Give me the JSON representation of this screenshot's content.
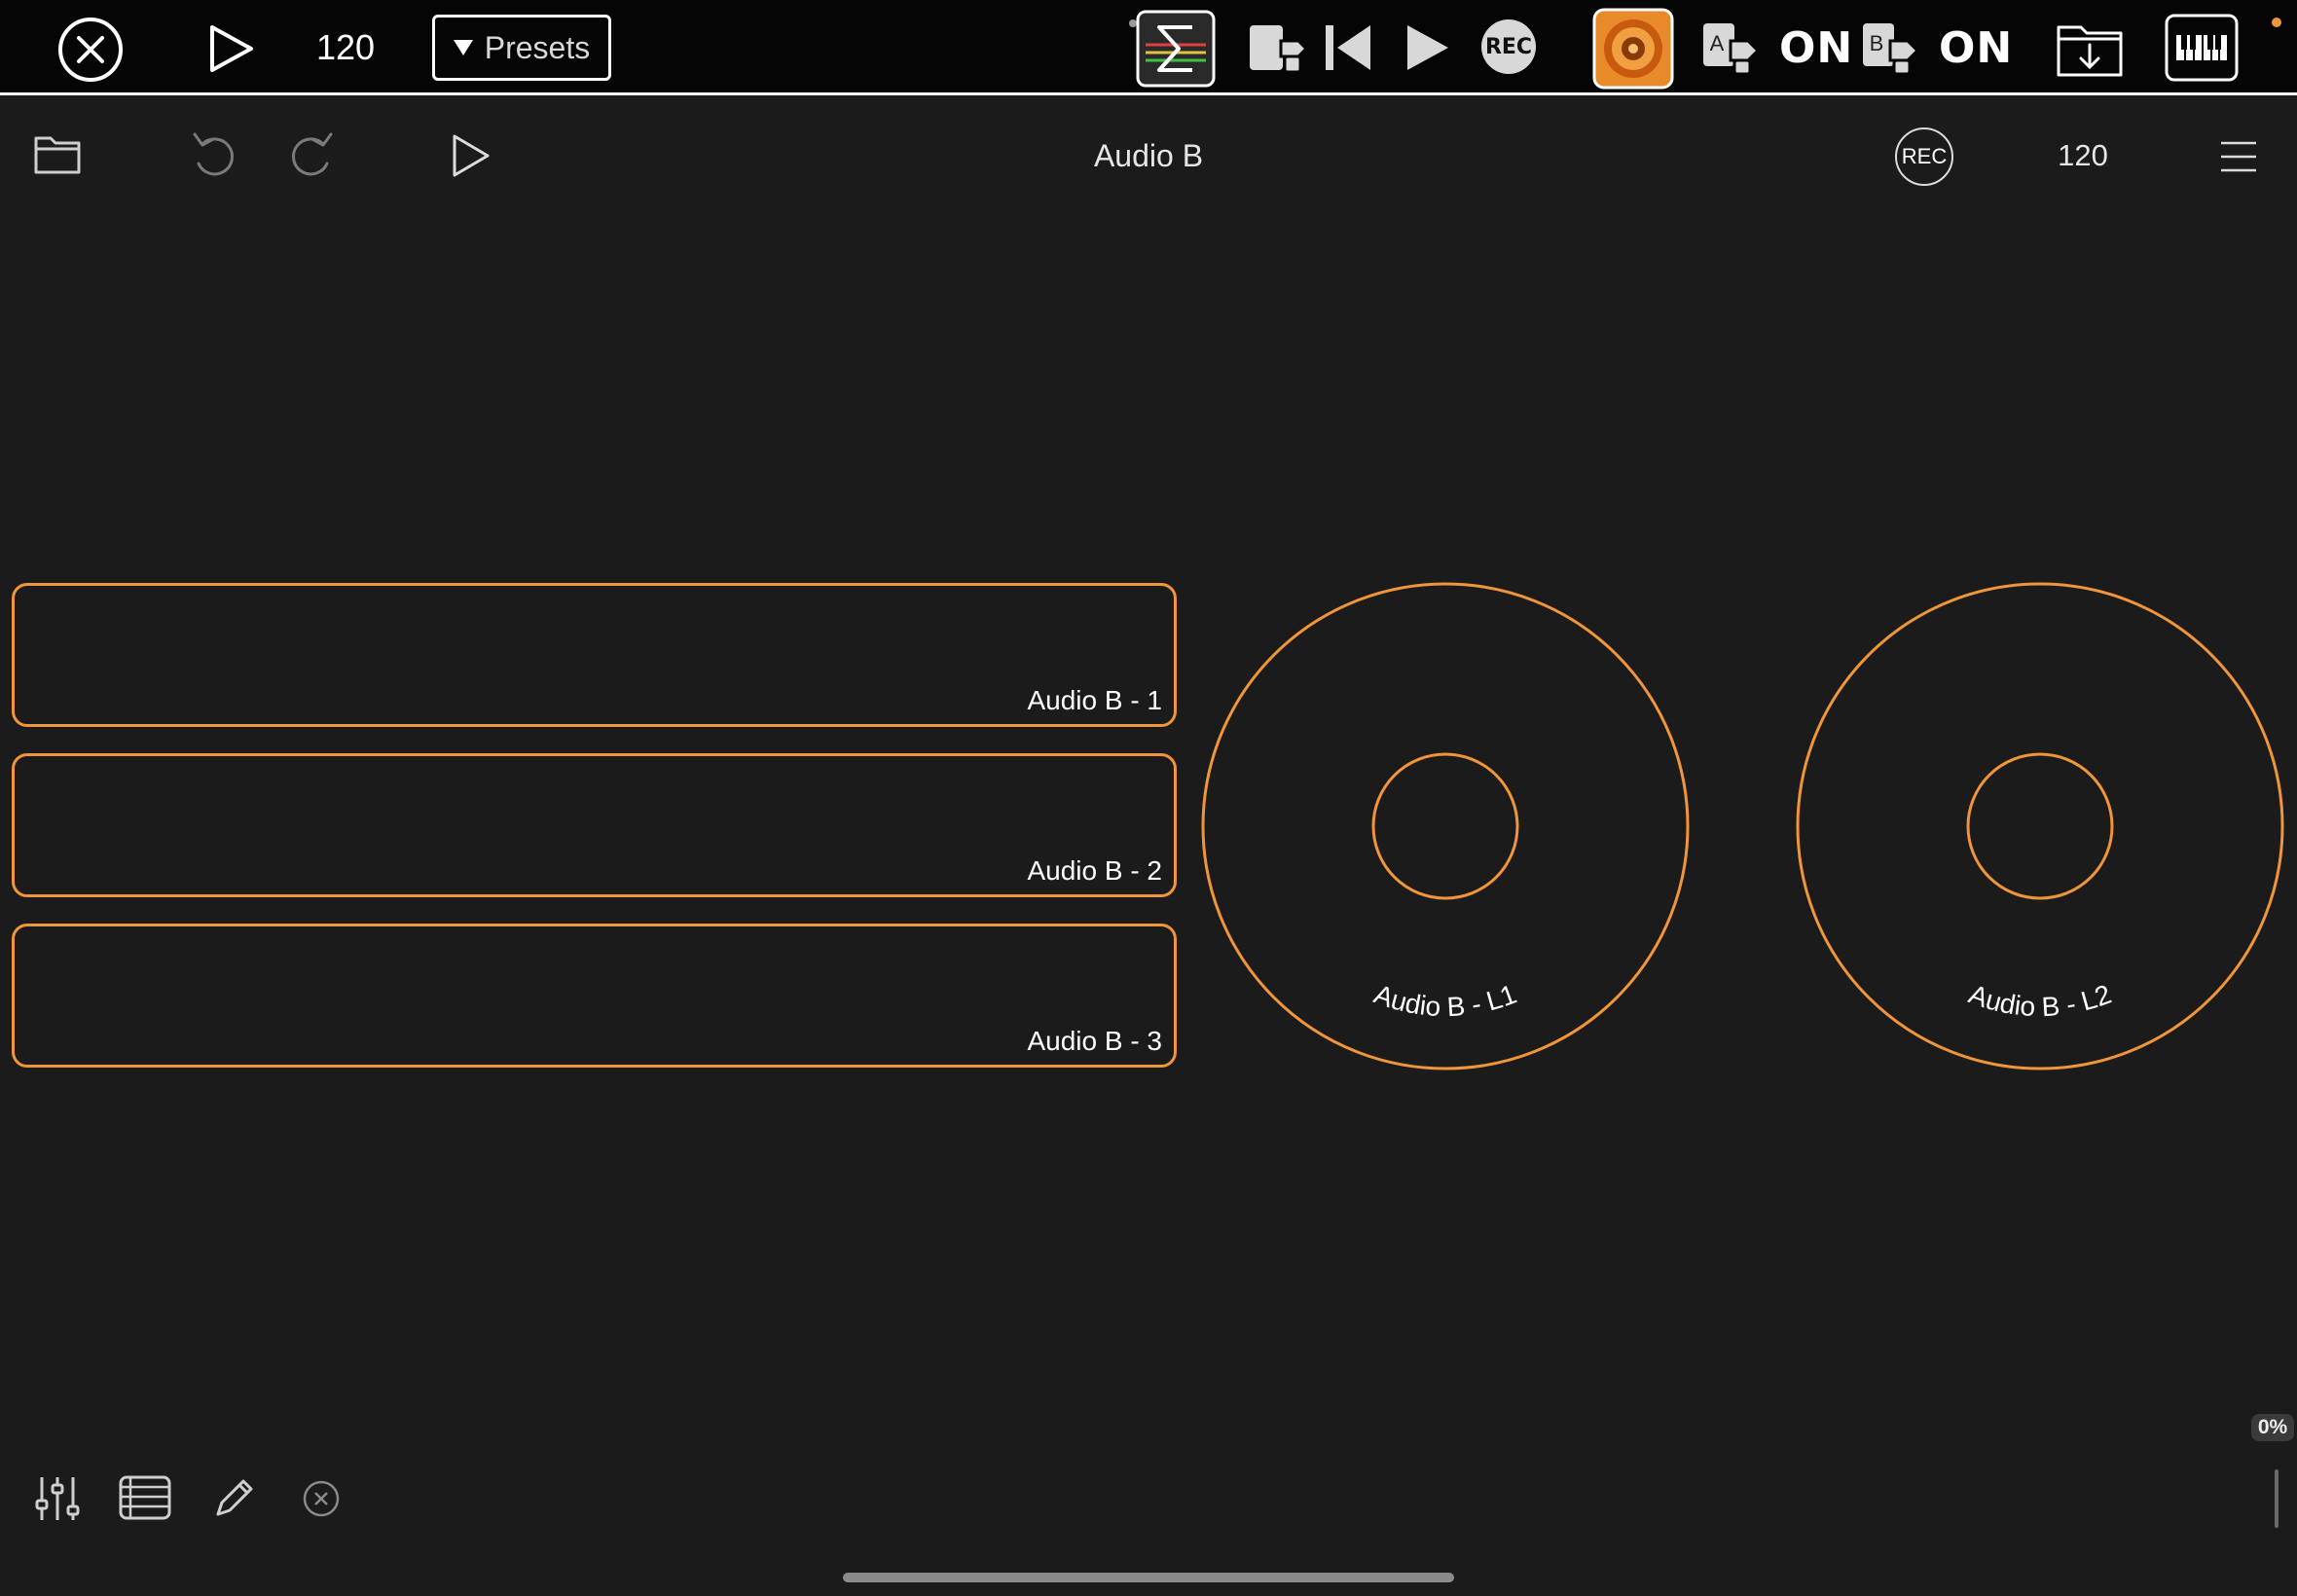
{
  "host_bar": {
    "tempo": "120",
    "presets_label": "Presets",
    "rec_label": "REC",
    "a_label": "A",
    "b_label": "B",
    "a_state": "ON",
    "b_state": "ON"
  },
  "app_toolbar": {
    "title": "Audio B",
    "rec_label": "REC",
    "tempo": "120"
  },
  "pads": [
    {
      "label": "Audio B - 1"
    },
    {
      "label": "Audio B - 2"
    },
    {
      "label": "Audio B - 3"
    }
  ],
  "loopers": [
    {
      "label": "Audio B - L1"
    },
    {
      "label": "Audio B - L2"
    }
  ],
  "status": {
    "percent": "0%"
  },
  "colors": {
    "accent": "#f0953a",
    "background": "#1b1b1b",
    "host_bar": "#050505"
  },
  "icons": {
    "close": "close-circle-icon",
    "play": "play-icon",
    "sigma": "sigma-icon",
    "rewind": "skip-back-icon",
    "plugin": "plugin-orange-icon",
    "folder": "folder-icon",
    "undo": "undo-icon",
    "redo": "redo-icon",
    "menu": "hamburger-menu-icon",
    "mixer": "sliders-icon",
    "list": "list-icon",
    "edit": "pencil-icon",
    "clear": "small-close-icon",
    "download": "folder-download-icon",
    "keyboard": "piano-keyboard-icon"
  }
}
